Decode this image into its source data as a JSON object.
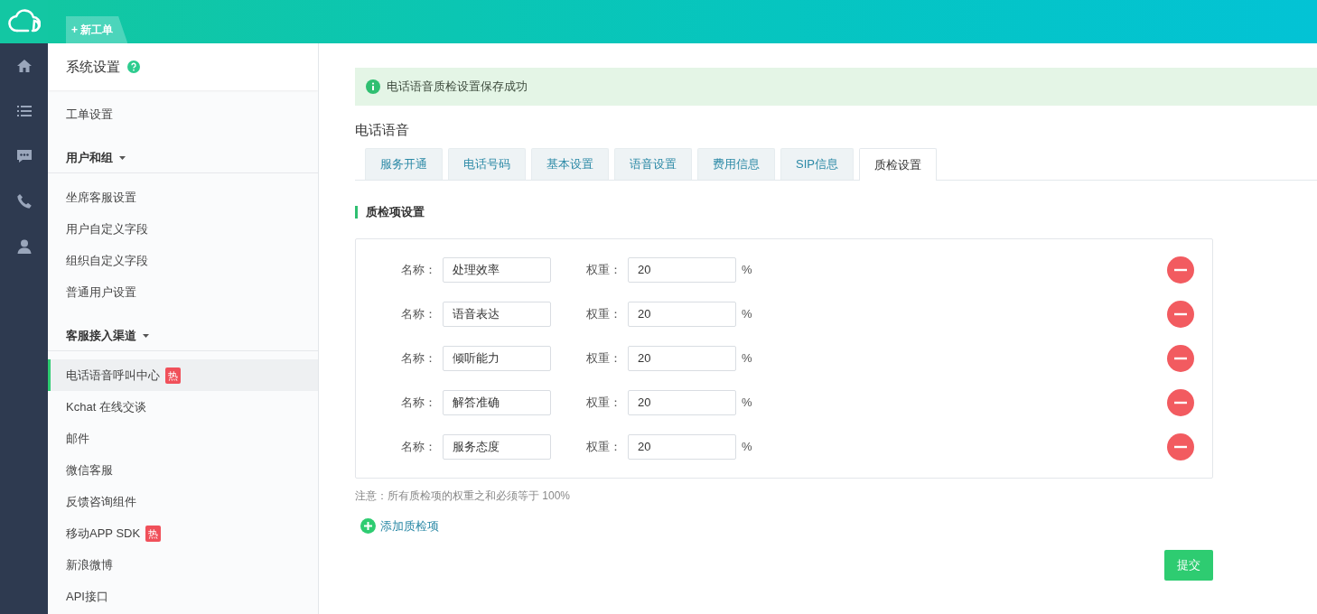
{
  "top_bar": {
    "new_ticket_tab": "+ 新工单"
  },
  "rail": {
    "items": [
      {
        "kind": "home"
      },
      {
        "kind": "list"
      },
      {
        "kind": "chat"
      },
      {
        "kind": "phone"
      },
      {
        "kind": "user"
      }
    ]
  },
  "sidebar": {
    "title": "系统设置",
    "sections": [
      {
        "items": [
          {
            "label": "工单设置",
            "selected": false
          }
        ]
      },
      {
        "heading": "用户和组",
        "items": [
          {
            "label": "坐席客服设置",
            "selected": false
          },
          {
            "label": "用户自定义字段",
            "selected": false
          },
          {
            "label": "组织自定义字段",
            "selected": false
          },
          {
            "label": "普通用户设置",
            "selected": false
          }
        ]
      },
      {
        "heading": "客服接入渠道",
        "items": [
          {
            "label": "电话语音呼叫中心",
            "selected": true,
            "badge": "热"
          },
          {
            "label": "Kchat 在线交谈",
            "selected": false
          },
          {
            "label": "邮件",
            "selected": false
          },
          {
            "label": "微信客服",
            "selected": false
          },
          {
            "label": "反馈咨询组件",
            "selected": false
          },
          {
            "label": "移动APP SDK",
            "selected": false,
            "badge": "热"
          },
          {
            "label": "新浪微博",
            "selected": false
          },
          {
            "label": "API接口",
            "selected": false
          }
        ]
      }
    ]
  },
  "alert": "电话语音质检设置保存成功",
  "page_title": "电话语音",
  "tabs": [
    {
      "label": "服务开通",
      "selected": false
    },
    {
      "label": "电话号码",
      "selected": false
    },
    {
      "label": "基本设置",
      "selected": false
    },
    {
      "label": "语音设置",
      "selected": false
    },
    {
      "label": "费用信息",
      "selected": false
    },
    {
      "label": "SIP信息",
      "selected": false
    },
    {
      "label": "质检设置",
      "selected": true
    }
  ],
  "section_title": "质检项设置",
  "items": [
    {
      "name_label": "名称：",
      "name": "处理效率",
      "weight_label": "权重：",
      "weight": "20",
      "unit": "%"
    },
    {
      "name_label": "名称：",
      "name": "语音表达",
      "weight_label": "权重：",
      "weight": "20",
      "unit": "%"
    },
    {
      "name_label": "名称：",
      "name": "倾听能力",
      "weight_label": "权重：",
      "weight": "20",
      "unit": "%"
    },
    {
      "name_label": "名称：",
      "name": "解答准确",
      "weight_label": "权重：",
      "weight": "20",
      "unit": "%"
    },
    {
      "name_label": "名称：",
      "name": "服务态度",
      "weight_label": "权重：",
      "weight": "20",
      "unit": "%"
    }
  ],
  "note": "注意：所有质检项的权重之和必须等于 100%",
  "add_button": "添加质检项",
  "submit_button": "提交"
}
